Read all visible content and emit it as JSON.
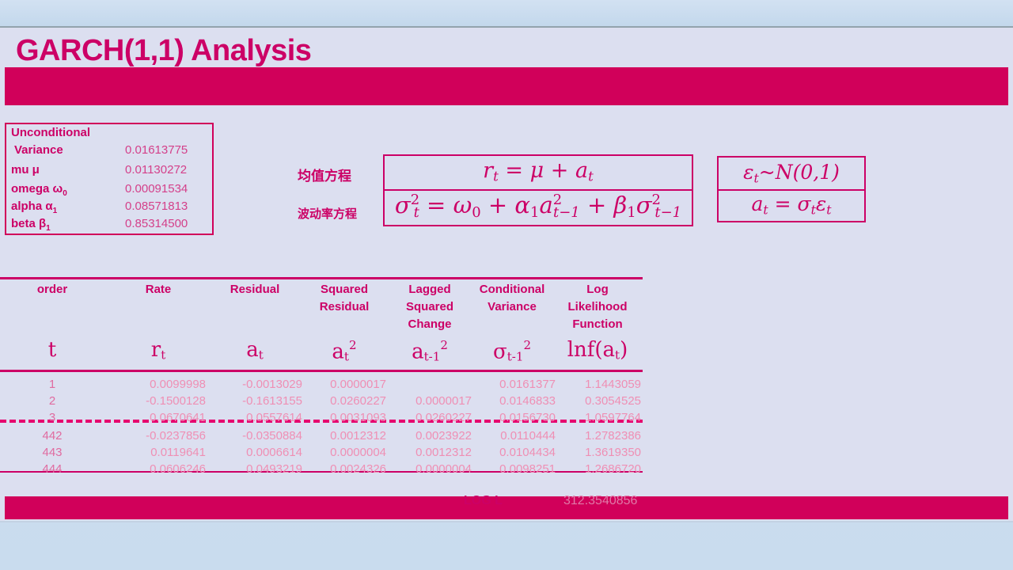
{
  "slide": {
    "title": "GARCH(1,1) Analysis"
  },
  "colors": {
    "accent": "#cc0066",
    "bar": "#d1005a",
    "slide_bg": "#dcdff0",
    "page_bg": "#cfdff0",
    "data_text": "#ef8fb4"
  },
  "params": {
    "rows": [
      {
        "label": "Unconditional",
        "label2": "Variance",
        "value": "0.01613775"
      },
      {
        "label": "mu μ",
        "value": "0.01130272"
      },
      {
        "label": "omega ω",
        "sub": "0",
        "value": "0.00091534"
      },
      {
        "label": "alpha α",
        "sub": "1",
        "value": "0.08571813"
      },
      {
        "label": "beta β",
        "sub": "1",
        "value": "0.85314500"
      }
    ]
  },
  "equations": {
    "mean_label": "均值方程",
    "volatility_label": "波动率方程",
    "mean_eq": "rₜ = μ + aₜ",
    "volatility_eq": "σ²ₜ = ω₀ + α₁a²ₜ₋₁ + β₁σ²ₜ₋₁",
    "side_eq_1": "εₜ~N(0,1)",
    "side_eq_2": "aₜ = σₜεₜ"
  },
  "table": {
    "headers": [
      {
        "words": [
          "order"
        ],
        "symbol": "t"
      },
      {
        "words": [
          "Rate"
        ],
        "symbol": "rₜ"
      },
      {
        "words": [
          "Residual"
        ],
        "symbol": "aₜ"
      },
      {
        "words": [
          "Squared",
          "Residual"
        ],
        "symbol": "aₜ²"
      },
      {
        "words": [
          "Lagged",
          "Squared",
          "Change"
        ],
        "symbol": "aₜ₋₁²"
      },
      {
        "words": [
          "Conditional",
          "Variance"
        ],
        "symbol": "σₜ₋₁²"
      },
      {
        "words": [
          "Log",
          "Likelihood",
          "Function"
        ],
        "symbol": "lnf(aₜ)"
      }
    ],
    "rows_top": [
      {
        "order": "1",
        "rate": "0.0099998",
        "residual": "-0.0013029",
        "sq_residual": "0.0000017",
        "lagged_sq": "",
        "cond_var": "0.0161377",
        "loglik": "1.1443059"
      },
      {
        "order": "2",
        "rate": "-0.1500128",
        "residual": "-0.1613155",
        "sq_residual": "0.0260227",
        "lagged_sq": "0.0000017",
        "cond_var": "0.0146833",
        "loglik": "0.3054525"
      },
      {
        "order": "3",
        "rate": "0.0670641",
        "residual": "0.0557614",
        "sq_residual": "0.0031093",
        "lagged_sq": "0.0260227",
        "cond_var": "0.0156730",
        "loglik": "1.0597764"
      }
    ],
    "rows_bottom": [
      {
        "order": "442",
        "rate": "-0.0237856",
        "residual": "-0.0350884",
        "sq_residual": "0.0012312",
        "lagged_sq": "0.0023922",
        "cond_var": "0.0110444",
        "loglik": "1.2782386"
      },
      {
        "order": "443",
        "rate": "0.0119641",
        "residual": "0.0006614",
        "sq_residual": "0.0000004",
        "lagged_sq": "0.0012312",
        "cond_var": "0.0104434",
        "loglik": "1.3619350"
      },
      {
        "order": "444",
        "rate": "0.0606246",
        "residual": "0.0493219",
        "sq_residual": "0.0024326",
        "lagged_sq": "0.0000004",
        "cond_var": "0.0098251",
        "loglik": "1.2686720"
      }
    ],
    "footer": {
      "label": "LOG L",
      "value": "312.3540856"
    }
  }
}
